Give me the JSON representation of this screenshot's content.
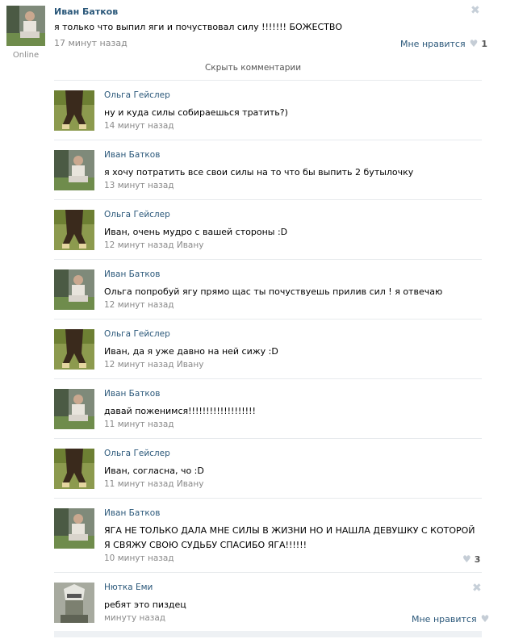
{
  "post": {
    "author": "Иван Батков",
    "text": "я только что выпил яги и почуствовал силу !!!!!!! БОЖЕСТВО",
    "time": "17 минут назад",
    "online": "Online",
    "like_label": "Мне нравится",
    "like_count": "1",
    "hide_comments": "Скрыть комментарии"
  },
  "comments": [
    {
      "author": "Ольга Гейслер",
      "text": "ну и куда силы собираешься тратить?)",
      "time": "14 минут назад",
      "avatar": "olga"
    },
    {
      "author": "Иван Батков",
      "text": "я хочу потратить все свои силы на то что бы выпить 2 бутылочку",
      "time": "13 минут назад",
      "avatar": "ivan"
    },
    {
      "author": "Ольга Гейслер",
      "text": "Иван, очень мудро с вашей стороны :D",
      "time": "12 минут назад Ивану",
      "avatar": "olga"
    },
    {
      "author": "Иван Батков",
      "text": "Ольга попробуй ягу прямо щас ты почуствуешь прилив сил ! я отвечаю",
      "time": "12 минут назад",
      "avatar": "ivan"
    },
    {
      "author": "Ольга Гейслер",
      "text": "Иван, да я уже давно на ней сижу :D",
      "time": "12 минут назад Ивану",
      "avatar": "olga"
    },
    {
      "author": "Иван Батков",
      "text": "давай поженимся!!!!!!!!!!!!!!!!!!!",
      "time": "11 минут назад",
      "avatar": "ivan"
    },
    {
      "author": "Ольга Гейслер",
      "text": "Иван, согласна, чо :D",
      "time": "11 минут назад Ивану",
      "avatar": "olga"
    },
    {
      "author": "Иван Батков",
      "text": "ЯГА НЕ ТОЛЬКО ДАЛА МНЕ СИЛЫ В ЖИЗНИ НО И НАШЛА ДЕВУШКУ С КОТОРОЙ Я СВЯЖУ СВОЮ СУДЬБУ СПАСИБО ЯГА!!!!!!",
      "time": "10 минут назад",
      "avatar": "ivan",
      "like_count": "3"
    },
    {
      "author": "Нютка Еми",
      "text": "ребят это пиздец",
      "time": "минуту назад",
      "avatar": "nyutka",
      "like_label": "Мне нравится"
    }
  ],
  "icons": {
    "close": "close-icon",
    "like": "heart-icon"
  }
}
